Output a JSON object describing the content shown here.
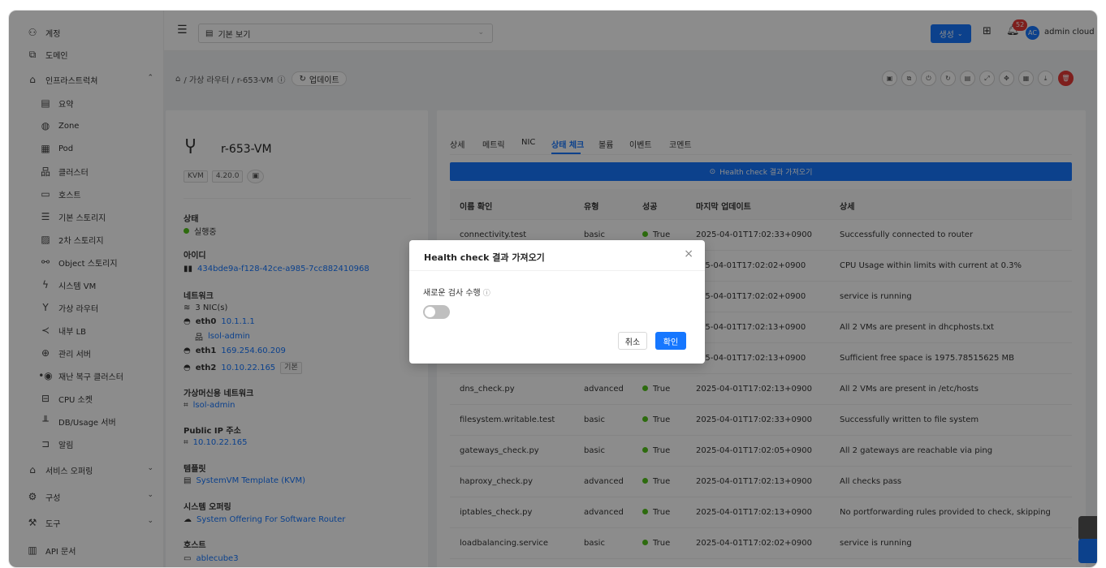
{
  "sidebar": {
    "items": [
      {
        "label": "계정",
        "icon": "team-icon"
      },
      {
        "label": "도메인",
        "icon": "domain-icon"
      },
      {
        "label": "인프라스트럭쳐",
        "icon": "bank-icon"
      },
      {
        "label": "요약",
        "icon": "summary-icon"
      },
      {
        "label": "Zone",
        "icon": "globe-icon"
      },
      {
        "label": "Pod",
        "icon": "grid-icon"
      },
      {
        "label": "클러스터",
        "icon": "cluster-icon"
      },
      {
        "label": "호스트",
        "icon": "host-icon"
      },
      {
        "label": "기본 스토리지",
        "icon": "database-icon"
      },
      {
        "label": "2차 스토리지",
        "icon": "image-icon"
      },
      {
        "label": "Object 스토리지",
        "icon": "object-icon"
      },
      {
        "label": "시스템 VM",
        "icon": "thunder-icon"
      },
      {
        "label": "가상 라우터",
        "icon": "router-icon"
      },
      {
        "label": "내부 LB",
        "icon": "share-icon"
      },
      {
        "label": "관리 서버",
        "icon": "server-icon"
      },
      {
        "label": "재난 복구 클러스터",
        "icon": "dr-icon"
      },
      {
        "label": "CPU 소켓",
        "icon": "cpu-icon"
      },
      {
        "label": "DB/Usage 서버",
        "icon": "chart-icon"
      },
      {
        "label": "알림",
        "icon": "alert-icon"
      },
      {
        "label": "서비스 오퍼링",
        "icon": "shopping-icon"
      },
      {
        "label": "구성",
        "icon": "gear-icon"
      },
      {
        "label": "도구",
        "icon": "tool-icon"
      },
      {
        "label": "API 문서",
        "icon": "book-icon"
      }
    ]
  },
  "topbar": {
    "view_label": "기본 보기",
    "create_label": "생성",
    "notification_count": "52",
    "avatar_initials": "AC",
    "user_name": "admin cloud"
  },
  "breadcrumb": {
    "path": "/ 가상 라우터 / r-653-VM",
    "update_label": "업데이트"
  },
  "vm": {
    "name": "r-653-VM",
    "hypervisor_tag": "KVM",
    "version_tag": "4.20.0",
    "state_label": "상태",
    "state_value": "실행중",
    "id_label": "아이디",
    "id_value": "434bde9a-f128-42ce-a985-7cc882410968",
    "network_label": "네트워크",
    "nic_count": "3 NIC(s)",
    "eth0_name": "eth0",
    "eth0_ip": "10.1.1.1",
    "eth0_net": "lsol-admin",
    "eth1_name": "eth1",
    "eth1_ip": "169.254.60.209",
    "eth2_name": "eth2",
    "eth2_ip": "10.10.22.165",
    "eth2_tag": "기본",
    "guest_net_label": "가상머신용 네트워크",
    "guest_net_value": "lsol-admin",
    "public_ip_label": "Public IP 주소",
    "public_ip_value": "10.10.22.165",
    "template_label": "템플릿",
    "template_value": "SystemVM Template (KVM)",
    "offering_label": "시스템 오퍼링",
    "offering_value": "System Offering For Software Router",
    "host_label": "호스트",
    "host_value": "ablecube3"
  },
  "tabs": [
    "상세",
    "메트릭",
    "NIC",
    "상태 체크",
    "볼륨",
    "이벤트",
    "코멘트"
  ],
  "health_button": "Health check 결과 가져오기",
  "table": {
    "headers": [
      "이름 확인",
      "유형",
      "성공",
      "마지막 업데이트",
      "상세"
    ],
    "rows": [
      {
        "name": "connectivity.test",
        "type": "basic",
        "success": "True",
        "updated": "2025-04-01T17:02:33+0900",
        "detail": "Successfully connected to router"
      },
      {
        "name": "",
        "type": "",
        "success": "",
        "updated": "25-04-01T17:02:02+0900",
        "detail": "CPU Usage within limits with current at 0.3%"
      },
      {
        "name": "",
        "type": "",
        "success": "",
        "updated": "25-04-01T17:02:02+0900",
        "detail": "service is running"
      },
      {
        "name": "",
        "type": "",
        "success": "",
        "updated": "25-04-01T17:02:13+0900",
        "detail": "All 2 VMs are present in dhcphosts.txt"
      },
      {
        "name": "",
        "type": "",
        "success": "",
        "updated": "25-04-01T17:02:13+0900",
        "detail": "Sufficient free space is 1975.78515625 MB"
      },
      {
        "name": "dns_check.py",
        "type": "advanced",
        "success": "True",
        "updated": "2025-04-01T17:02:13+0900",
        "detail": "All 2 VMs are present in /etc/hosts"
      },
      {
        "name": "filesystem.writable.test",
        "type": "basic",
        "success": "True",
        "updated": "2025-04-01T17:02:33+0900",
        "detail": "Successfully written to file system"
      },
      {
        "name": "gateways_check.py",
        "type": "basic",
        "success": "True",
        "updated": "2025-04-01T17:02:05+0900",
        "detail": "All 2 gateways are reachable via ping"
      },
      {
        "name": "haproxy_check.py",
        "type": "advanced",
        "success": "True",
        "updated": "2025-04-01T17:02:13+0900",
        "detail": "All checks pass"
      },
      {
        "name": "iptables_check.py",
        "type": "advanced",
        "success": "True",
        "updated": "2025-04-01T17:02:13+0900",
        "detail": "No portforwarding rules provided to check, skipping"
      },
      {
        "name": "loadbalancing.service",
        "type": "basic",
        "success": "True",
        "updated": "2025-04-01T17:02:02+0900",
        "detail": "service is running"
      }
    ]
  },
  "modal": {
    "title": "Health check 결과 가져오기",
    "option_label": "새로운 검사 수행",
    "cancel": "취소",
    "ok": "확인"
  },
  "colors": {
    "primary": "#1677ff",
    "success": "#52c41a",
    "danger": "#e53935"
  }
}
